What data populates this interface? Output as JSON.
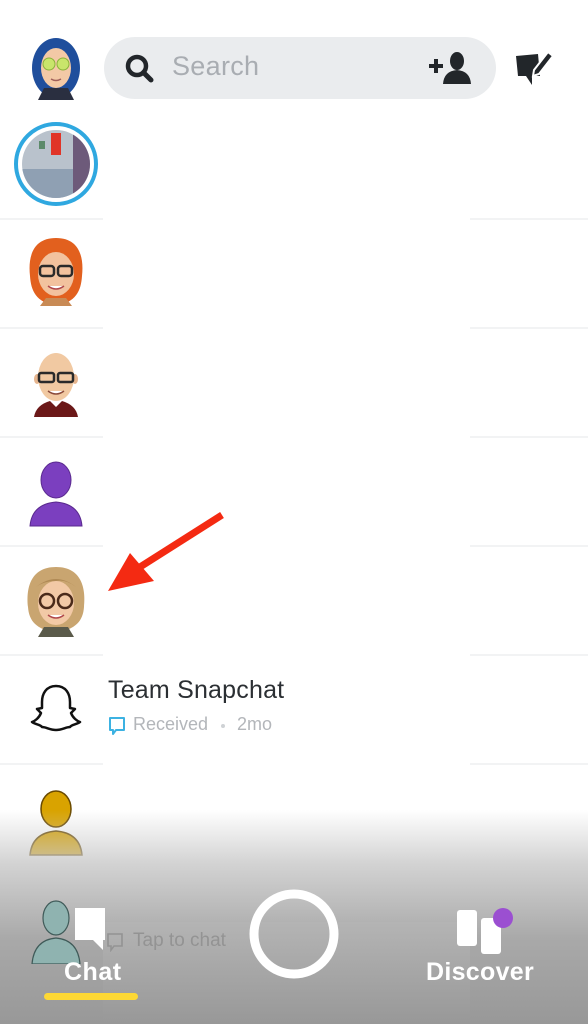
{
  "top_bar": {
    "profile_avatar": "bitmoji-avatar-blue-hair",
    "search_placeholder": "Search",
    "search_icon": "search-icon",
    "add_friend_icon": "add-friend-icon",
    "new_chat_icon": "new-chat-icon"
  },
  "chat_list": {
    "rows": [
      {
        "avatar": "story-photo-avatar",
        "has_story_ring": true,
        "story_ring_color": "#2fa8e0",
        "name": "",
        "status": ""
      },
      {
        "avatar": "bitmoji-red-hair-glasses",
        "name": "",
        "status": ""
      },
      {
        "avatar": "bitmoji-bald-glasses",
        "name": "",
        "status": ""
      },
      {
        "avatar": "default-avatar-purple",
        "color": "#7b3fbf",
        "name": "",
        "status": ""
      },
      {
        "avatar": "bitmoji-blonde-glasses",
        "name": "",
        "status": "",
        "highlighted_by_arrow": true
      },
      {
        "avatar": "snapchat-ghost-icon",
        "name": "Team Snapchat",
        "status": "Received",
        "time": "2mo",
        "status_color": "#3cb2e2"
      },
      {
        "avatar": "default-avatar-gold",
        "color": "#d9a300",
        "name": "",
        "status": ""
      },
      {
        "avatar": "default-avatar-teal",
        "color": "#8fb3b0",
        "name": "",
        "status": "Tap to chat"
      }
    ]
  },
  "annotation": {
    "arrow_color": "#f42a12"
  },
  "bottom_nav": {
    "chat_label": "Chat",
    "chat_active": true,
    "active_indicator_color": "#fdd835",
    "discover_label": "Discover",
    "discover_badge_color": "#9b4fd1"
  }
}
